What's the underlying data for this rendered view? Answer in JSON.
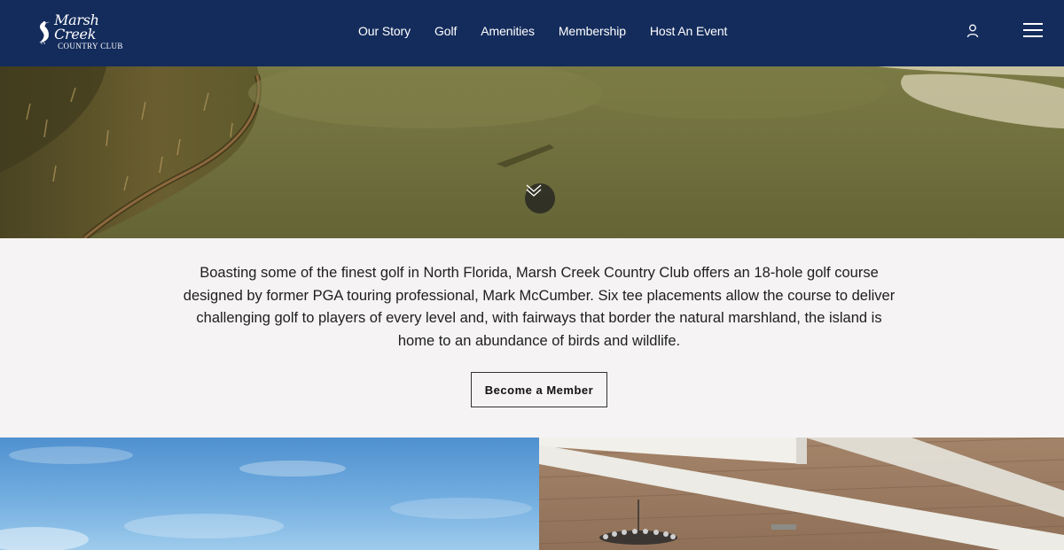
{
  "header": {
    "logo": {
      "script_text": "Marsh Creek",
      "sub_text": "COUNTRY CLUB"
    },
    "nav": [
      {
        "label": "Our Story"
      },
      {
        "label": "Golf"
      },
      {
        "label": "Amenities"
      },
      {
        "label": "Membership"
      },
      {
        "label": "Host An Event"
      }
    ],
    "icons": {
      "account": "user-icon",
      "menu": "hamburger-menu-icon"
    }
  },
  "hero": {
    "scroll_icon": "double-chevron-down-icon"
  },
  "intro": {
    "text": "Boasting some of the finest golf in North Florida, Marsh Creek Country Club offers an 18-hole golf course designed by former PGA touring professional, Mark McCumber. Six tee placements allow the course to deliver challenging golf to players of every level and, with fairways that border the natural marshland, the island is home to an abundance of birds and wildlife.",
    "cta_label": "Become a Member"
  },
  "colors": {
    "header_bg": "#142c5c",
    "section_bg": "#f5f3f3",
    "text": "#1e1e1e"
  }
}
